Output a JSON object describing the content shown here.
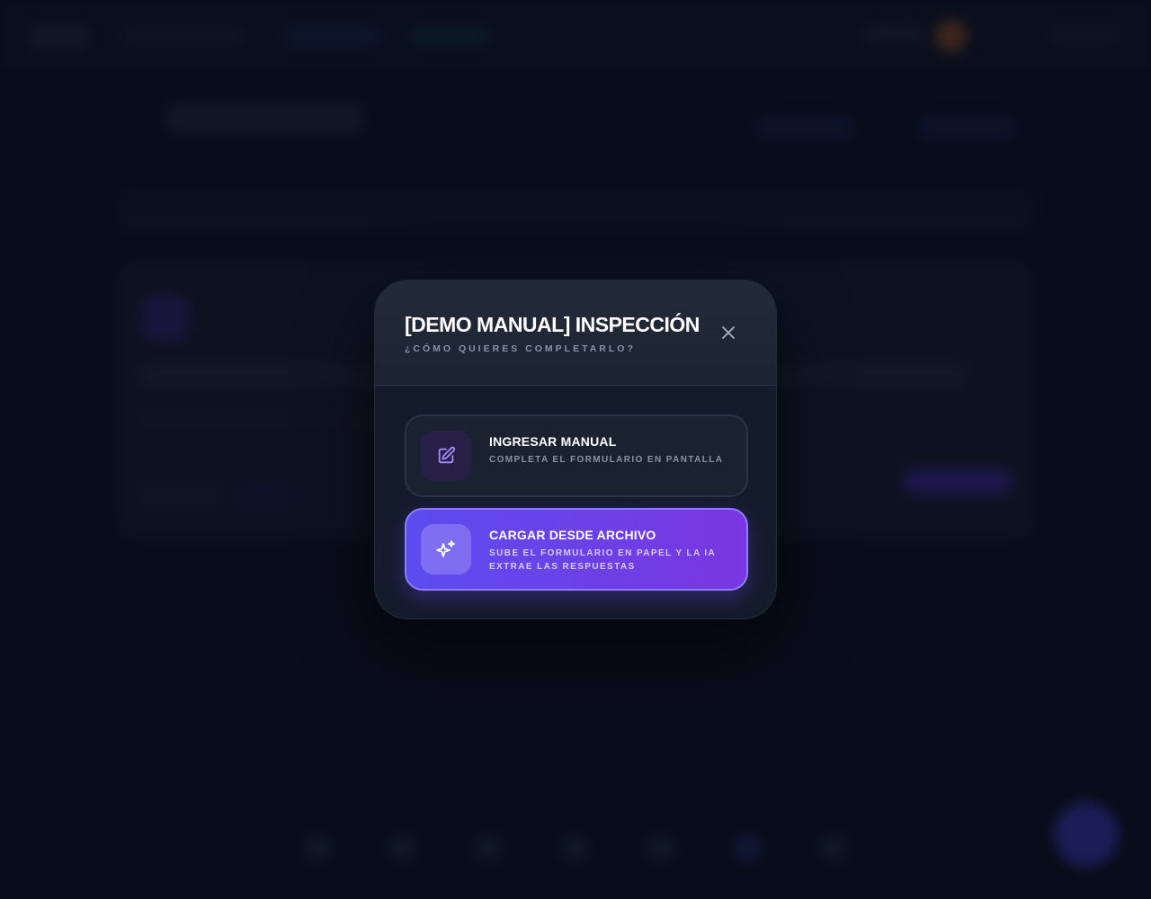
{
  "modal": {
    "title": "[DEMO MANUAL] INSPECCIÓN",
    "subtitle": "¿CÓMO QUIERES COMPLETARLO?",
    "close_icon": "close-icon"
  },
  "options": [
    {
      "title": "INGRESAR MANUAL",
      "description": "COMPLETA EL FORMULARIO EN PANTALLA",
      "icon": "edit-icon",
      "icon_color": "#a78bfa"
    },
    {
      "title": "CARGAR DESDE ARCHIVO",
      "description": "SUBE EL FORMULARIO EN PAPEL Y LA IA EXTRAE LAS RESPUESTAS",
      "icon": "sparkles-icon",
      "icon_color": "#ffffff"
    }
  ],
  "colors": {
    "background": "#0b1120",
    "accent_start": "#5b4cf0",
    "accent_end": "#7a36e0"
  }
}
